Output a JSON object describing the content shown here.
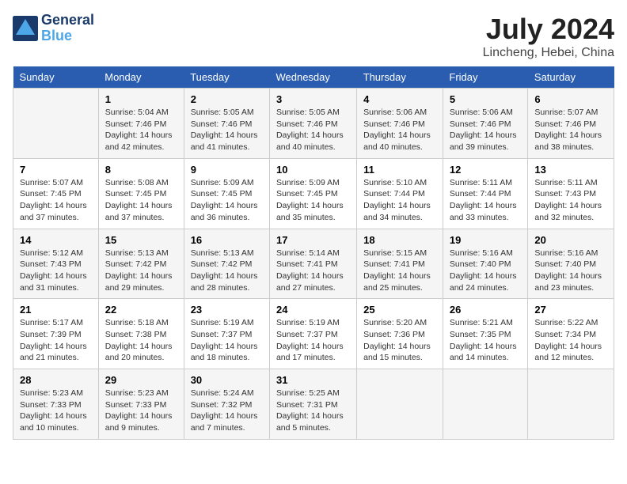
{
  "header": {
    "logo_line1": "General",
    "logo_line2": "Blue",
    "title": "July 2024",
    "subtitle": "Lincheng, Hebei, China"
  },
  "days_of_week": [
    "Sunday",
    "Monday",
    "Tuesday",
    "Wednesday",
    "Thursday",
    "Friday",
    "Saturday"
  ],
  "weeks": [
    [
      {
        "day": "",
        "info": ""
      },
      {
        "day": "1",
        "info": "Sunrise: 5:04 AM\nSunset: 7:46 PM\nDaylight: 14 hours\nand 42 minutes."
      },
      {
        "day": "2",
        "info": "Sunrise: 5:05 AM\nSunset: 7:46 PM\nDaylight: 14 hours\nand 41 minutes."
      },
      {
        "day": "3",
        "info": "Sunrise: 5:05 AM\nSunset: 7:46 PM\nDaylight: 14 hours\nand 40 minutes."
      },
      {
        "day": "4",
        "info": "Sunrise: 5:06 AM\nSunset: 7:46 PM\nDaylight: 14 hours\nand 40 minutes."
      },
      {
        "day": "5",
        "info": "Sunrise: 5:06 AM\nSunset: 7:46 PM\nDaylight: 14 hours\nand 39 minutes."
      },
      {
        "day": "6",
        "info": "Sunrise: 5:07 AM\nSunset: 7:46 PM\nDaylight: 14 hours\nand 38 minutes."
      }
    ],
    [
      {
        "day": "7",
        "info": "Sunrise: 5:07 AM\nSunset: 7:45 PM\nDaylight: 14 hours\nand 37 minutes."
      },
      {
        "day": "8",
        "info": "Sunrise: 5:08 AM\nSunset: 7:45 PM\nDaylight: 14 hours\nand 37 minutes."
      },
      {
        "day": "9",
        "info": "Sunrise: 5:09 AM\nSunset: 7:45 PM\nDaylight: 14 hours\nand 36 minutes."
      },
      {
        "day": "10",
        "info": "Sunrise: 5:09 AM\nSunset: 7:45 PM\nDaylight: 14 hours\nand 35 minutes."
      },
      {
        "day": "11",
        "info": "Sunrise: 5:10 AM\nSunset: 7:44 PM\nDaylight: 14 hours\nand 34 minutes."
      },
      {
        "day": "12",
        "info": "Sunrise: 5:11 AM\nSunset: 7:44 PM\nDaylight: 14 hours\nand 33 minutes."
      },
      {
        "day": "13",
        "info": "Sunrise: 5:11 AM\nSunset: 7:43 PM\nDaylight: 14 hours\nand 32 minutes."
      }
    ],
    [
      {
        "day": "14",
        "info": "Sunrise: 5:12 AM\nSunset: 7:43 PM\nDaylight: 14 hours\nand 31 minutes."
      },
      {
        "day": "15",
        "info": "Sunrise: 5:13 AM\nSunset: 7:42 PM\nDaylight: 14 hours\nand 29 minutes."
      },
      {
        "day": "16",
        "info": "Sunrise: 5:13 AM\nSunset: 7:42 PM\nDaylight: 14 hours\nand 28 minutes."
      },
      {
        "day": "17",
        "info": "Sunrise: 5:14 AM\nSunset: 7:41 PM\nDaylight: 14 hours\nand 27 minutes."
      },
      {
        "day": "18",
        "info": "Sunrise: 5:15 AM\nSunset: 7:41 PM\nDaylight: 14 hours\nand 25 minutes."
      },
      {
        "day": "19",
        "info": "Sunrise: 5:16 AM\nSunset: 7:40 PM\nDaylight: 14 hours\nand 24 minutes."
      },
      {
        "day": "20",
        "info": "Sunrise: 5:16 AM\nSunset: 7:40 PM\nDaylight: 14 hours\nand 23 minutes."
      }
    ],
    [
      {
        "day": "21",
        "info": "Sunrise: 5:17 AM\nSunset: 7:39 PM\nDaylight: 14 hours\nand 21 minutes."
      },
      {
        "day": "22",
        "info": "Sunrise: 5:18 AM\nSunset: 7:38 PM\nDaylight: 14 hours\nand 20 minutes."
      },
      {
        "day": "23",
        "info": "Sunrise: 5:19 AM\nSunset: 7:37 PM\nDaylight: 14 hours\nand 18 minutes."
      },
      {
        "day": "24",
        "info": "Sunrise: 5:19 AM\nSunset: 7:37 PM\nDaylight: 14 hours\nand 17 minutes."
      },
      {
        "day": "25",
        "info": "Sunrise: 5:20 AM\nSunset: 7:36 PM\nDaylight: 14 hours\nand 15 minutes."
      },
      {
        "day": "26",
        "info": "Sunrise: 5:21 AM\nSunset: 7:35 PM\nDaylight: 14 hours\nand 14 minutes."
      },
      {
        "day": "27",
        "info": "Sunrise: 5:22 AM\nSunset: 7:34 PM\nDaylight: 14 hours\nand 12 minutes."
      }
    ],
    [
      {
        "day": "28",
        "info": "Sunrise: 5:23 AM\nSunset: 7:33 PM\nDaylight: 14 hours\nand 10 minutes."
      },
      {
        "day": "29",
        "info": "Sunrise: 5:23 AM\nSunset: 7:33 PM\nDaylight: 14 hours\nand 9 minutes."
      },
      {
        "day": "30",
        "info": "Sunrise: 5:24 AM\nSunset: 7:32 PM\nDaylight: 14 hours\nand 7 minutes."
      },
      {
        "day": "31",
        "info": "Sunrise: 5:25 AM\nSunset: 7:31 PM\nDaylight: 14 hours\nand 5 minutes."
      },
      {
        "day": "",
        "info": ""
      },
      {
        "day": "",
        "info": ""
      },
      {
        "day": "",
        "info": ""
      }
    ]
  ]
}
